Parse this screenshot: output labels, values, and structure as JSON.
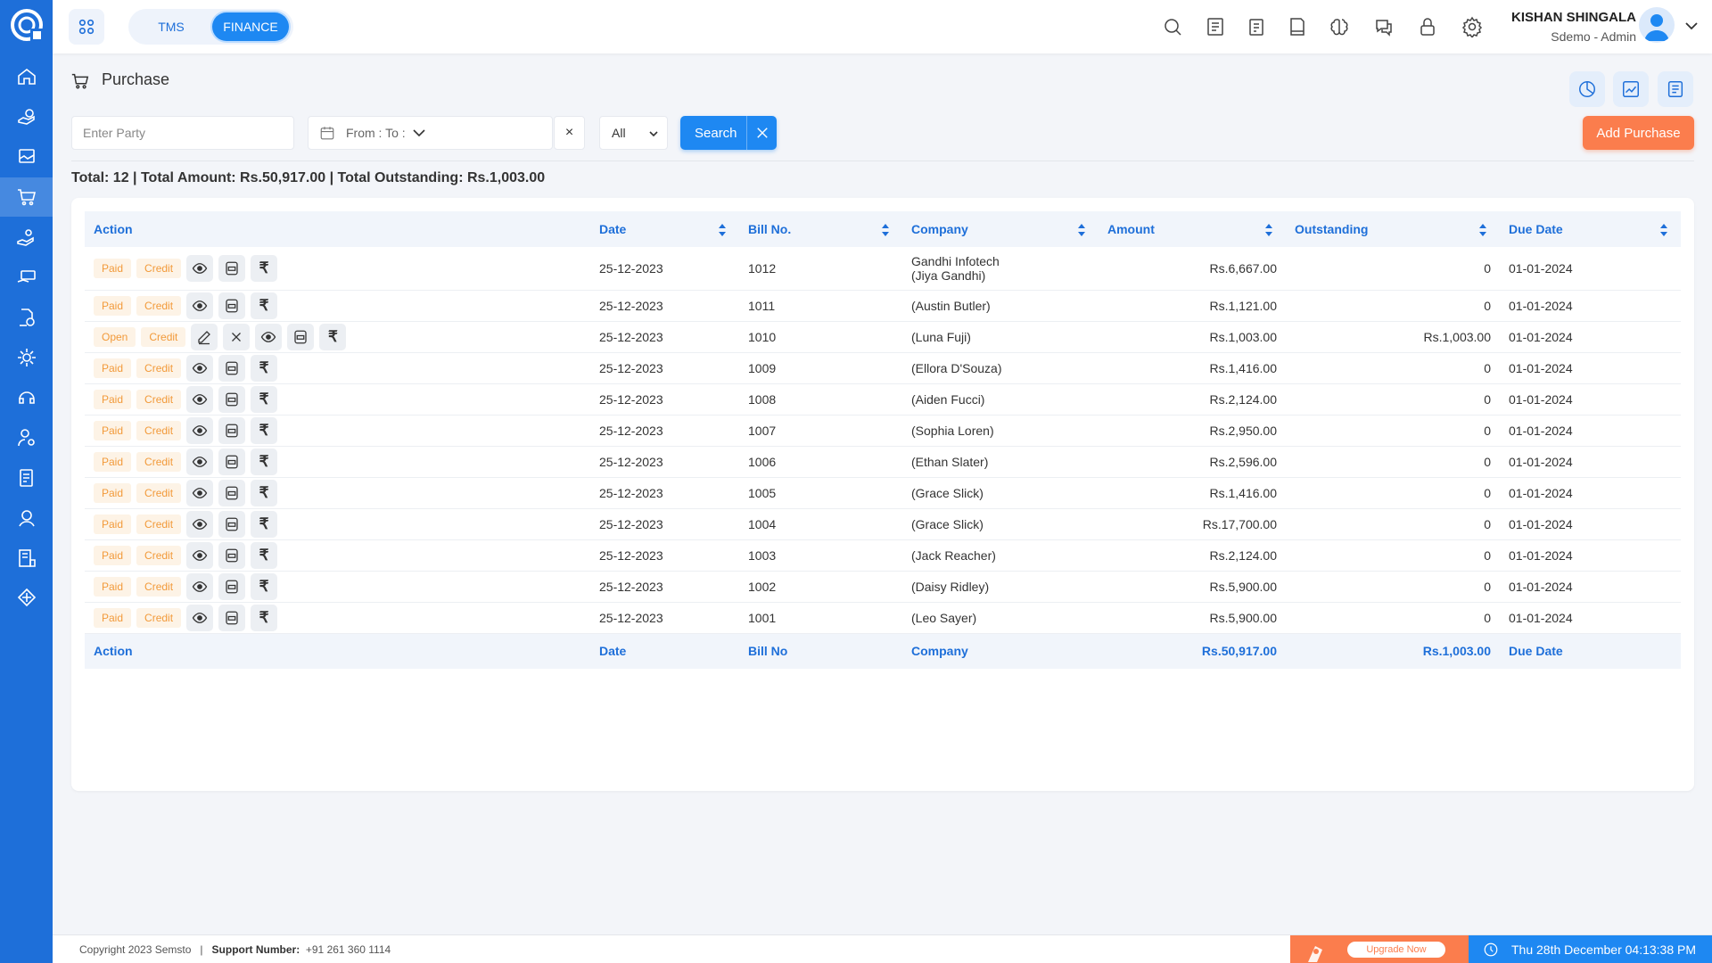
{
  "topbar": {
    "tabs": [
      "TMS",
      "FINANCE"
    ],
    "active_tab": "FINANCE",
    "user_name": "KISHAN SHINGALA",
    "user_role": "Sdemo - Admin"
  },
  "page": {
    "title": "Purchase"
  },
  "filters": {
    "party_placeholder": "Enter Party",
    "date_range_label": "From : To :",
    "date_clear": "×",
    "status_value": "All",
    "search_label": "Search",
    "add_label": "Add Purchase"
  },
  "totals": "Total: 12 | Total Amount: Rs.50,917.00 | Total Outstanding: Rs.1,003.00",
  "table": {
    "headers": [
      "Action",
      "Date",
      "Bill No.",
      "Company",
      "Amount",
      "Outstanding",
      "Due Date"
    ],
    "rows": [
      {
        "status": "Paid",
        "type": "Credit",
        "date": "25-12-2023",
        "bill": "1012",
        "company": "Gandhi Infotech",
        "contact": "(Jiya Gandhi)",
        "amount": "Rs.6,667.00",
        "outstanding": "0",
        "due": "01-01-2024"
      },
      {
        "status": "Paid",
        "type": "Credit",
        "date": "25-12-2023",
        "bill": "1011",
        "company": "",
        "contact": "(Austin Butler)",
        "amount": "Rs.1,121.00",
        "outstanding": "0",
        "due": "01-01-2024"
      },
      {
        "status": "Open",
        "type": "Credit",
        "date": "25-12-2023",
        "bill": "1010",
        "company": "",
        "contact": "(Luna Fuji)",
        "amount": "Rs.1,003.00",
        "outstanding": "Rs.1,003.00",
        "due": "01-01-2024"
      },
      {
        "status": "Paid",
        "type": "Credit",
        "date": "25-12-2023",
        "bill": "1009",
        "company": "",
        "contact": "(Ellora D'Souza)",
        "amount": "Rs.1,416.00",
        "outstanding": "0",
        "due": "01-01-2024"
      },
      {
        "status": "Paid",
        "type": "Credit",
        "date": "25-12-2023",
        "bill": "1008",
        "company": "",
        "contact": "(Aiden Fucci)",
        "amount": "Rs.2,124.00",
        "outstanding": "0",
        "due": "01-01-2024"
      },
      {
        "status": "Paid",
        "type": "Credit",
        "date": "25-12-2023",
        "bill": "1007",
        "company": "",
        "contact": "(Sophia Loren)",
        "amount": "Rs.2,950.00",
        "outstanding": "0",
        "due": "01-01-2024"
      },
      {
        "status": "Paid",
        "type": "Credit",
        "date": "25-12-2023",
        "bill": "1006",
        "company": "",
        "contact": "(Ethan Slater)",
        "amount": "Rs.2,596.00",
        "outstanding": "0",
        "due": "01-01-2024"
      },
      {
        "status": "Paid",
        "type": "Credit",
        "date": "25-12-2023",
        "bill": "1005",
        "company": "",
        "contact": "(Grace Slick)",
        "amount": "Rs.1,416.00",
        "outstanding": "0",
        "due": "01-01-2024"
      },
      {
        "status": "Paid",
        "type": "Credit",
        "date": "25-12-2023",
        "bill": "1004",
        "company": "",
        "contact": "(Grace Slick)",
        "amount": "Rs.17,700.00",
        "outstanding": "0",
        "due": "01-01-2024"
      },
      {
        "status": "Paid",
        "type": "Credit",
        "date": "25-12-2023",
        "bill": "1003",
        "company": "",
        "contact": "(Jack Reacher)",
        "amount": "Rs.2,124.00",
        "outstanding": "0",
        "due": "01-01-2024"
      },
      {
        "status": "Paid",
        "type": "Credit",
        "date": "25-12-2023",
        "bill": "1002",
        "company": "",
        "contact": "(Daisy Ridley)",
        "amount": "Rs.5,900.00",
        "outstanding": "0",
        "due": "01-01-2024"
      },
      {
        "status": "Paid",
        "type": "Credit",
        "date": "25-12-2023",
        "bill": "1001",
        "company": "",
        "contact": "(Leo Sayer)",
        "amount": "Rs.5,900.00",
        "outstanding": "0",
        "due": "01-01-2024"
      }
    ],
    "footer": {
      "action": "Action",
      "date": "Date",
      "bill": "Bill No",
      "company": "Company",
      "amount": "Rs.50,917.00",
      "outstanding": "Rs.1,003.00",
      "due": "Due Date"
    }
  },
  "footer": {
    "copyright": "Copyright 2023 Semsto",
    "support_label": "Support Number:",
    "support_number": "+91 261 360 1114",
    "upgrade_label": "Upgrade Now",
    "datetime": "Thu 28th December 04:13:38 PM"
  },
  "colors": {
    "primary": "#1e88f2",
    "sidebar": "#1e6fd9",
    "accent_orange": "#fb7d4d",
    "badge_text": "#f29a3a",
    "badge_bg": "#fdf3e6"
  }
}
